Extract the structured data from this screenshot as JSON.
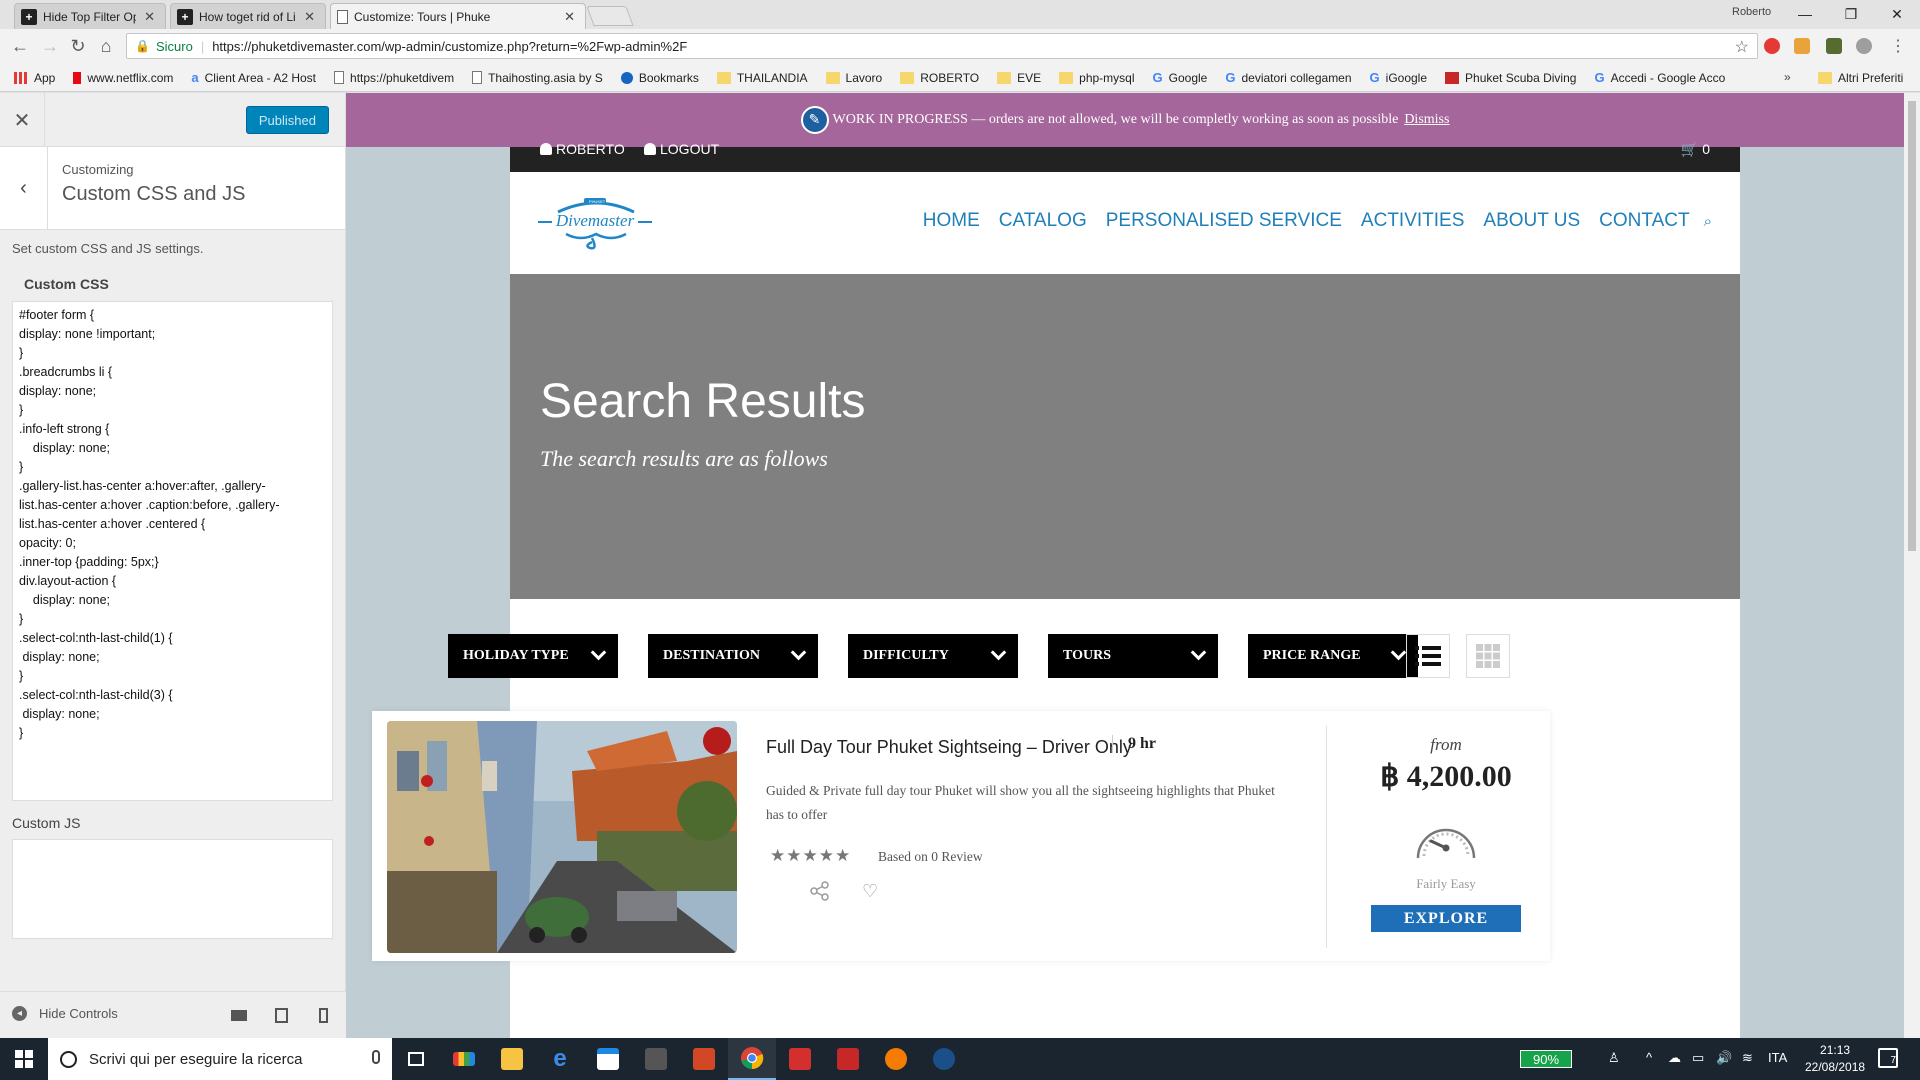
{
  "browser": {
    "tabs": [
      {
        "title": "Hide Top Filter Options fr",
        "icon": "plus"
      },
      {
        "title": "How toget rid of List and",
        "icon": "plus"
      },
      {
        "title": "Customize: Tours | Phuke",
        "icon": "doc"
      }
    ],
    "user": "Roberto",
    "secure_label": "Sicuro",
    "url": "https://phuketdivemaster.com/wp-admin/customize.php?return=%2Fwp-admin%2F",
    "bookmarks": [
      {
        "label": "App",
        "icon": "apps"
      },
      {
        "label": "www.netflix.com",
        "icon": "netflix"
      },
      {
        "label": "Client Area - A2 Host",
        "icon": "g"
      },
      {
        "label": "https://phuketdivem",
        "icon": "page"
      },
      {
        "label": "Thaihosting.asia by S",
        "icon": "page"
      },
      {
        "label": "Bookmarks",
        "icon": "blue"
      },
      {
        "label": "THAILANDIA",
        "icon": "folder"
      },
      {
        "label": "Lavoro",
        "icon": "folder"
      },
      {
        "label": "ROBERTO",
        "icon": "folder"
      },
      {
        "label": "EVE",
        "icon": "folder"
      },
      {
        "label": "php-mysql",
        "icon": "folder"
      },
      {
        "label": "Google",
        "icon": "g"
      },
      {
        "label": "deviatori collegamen",
        "icon": "g"
      },
      {
        "label": "iGoogle",
        "icon": "g"
      },
      {
        "label": "Phuket Scuba Diving",
        "icon": "red"
      },
      {
        "label": "Accedi - Google Acco",
        "icon": "g"
      }
    ],
    "bookmarks_more": "»",
    "other_bookmarks": "Altri Preferiti"
  },
  "customizer": {
    "publish_label": "Published",
    "crumb": "Customizing",
    "section_title": "Custom CSS and JS",
    "description": "Set custom CSS and JS settings.",
    "css_label": "Custom CSS",
    "css_value": "#footer form {\ndisplay: none !important;\n}\n.breadcrumbs li {\ndisplay: none;\n}\n.info-left strong {\n    display: none;\n}\n.gallery-list.has-center a:hover:after, .gallery-\nlist.has-center a:hover .caption:before, .gallery-\nlist.has-center a:hover .centered {\nopacity: 0;\n.inner-top {padding: 5px;}\ndiv.layout-action {\n    display: none;\n}\n.select-col:nth-last-child(1) {\n display: none;\n}\n.select-col:nth-last-child(3) {\n display: none;\n}",
    "js_label": "Custom JS",
    "js_value": "",
    "hide_controls": "Hide Controls"
  },
  "site": {
    "banner_text": "WORK IN PROGRESS — orders are not allowed, we will be completly working as soon as possible",
    "banner_dismiss": "Dismiss",
    "user_name": "ROBERTO",
    "logout": "LOGOUT",
    "cart_count": "0",
    "logo_text": "Divemaster",
    "logo_small": "PHUKET",
    "nav": [
      "HOME",
      "CATALOG",
      "PERSONALISED SERVICE",
      "ACTIVITIES",
      "ABOUT US",
      "CONTACT"
    ],
    "hero_title": "Search Results",
    "hero_subtitle": "The search results are as follows",
    "filters": [
      "HOLIDAY TYPE",
      "DESTINATION",
      "DIFFICULTY",
      "TOURS",
      "PRICE RANGE"
    ],
    "result": {
      "title": "Full Day Tour Phuket Sightseing – Driver Only",
      "duration": "9 hr",
      "description": "Guided & Private full day tour Phuket will show you all the sightseeing highlights that Phuket has to offer",
      "stars": "★★★★★",
      "reviews": "Based on 0 Review",
      "price_from": "from",
      "price": "฿ 4,200.00",
      "difficulty": "Fairly Easy",
      "cta": "EXPLORE"
    }
  },
  "taskbar": {
    "search_placeholder": "Scrivi qui per eseguire la ricerca",
    "battery": "90%",
    "lang": "ITA",
    "time": "21:13",
    "date": "22/08/2018",
    "notifications": "7"
  },
  "colors": {
    "banner": "#a5669b",
    "nav": "#1f7fb8",
    "hero": "#808080",
    "explore": "#1f6fb8"
  }
}
